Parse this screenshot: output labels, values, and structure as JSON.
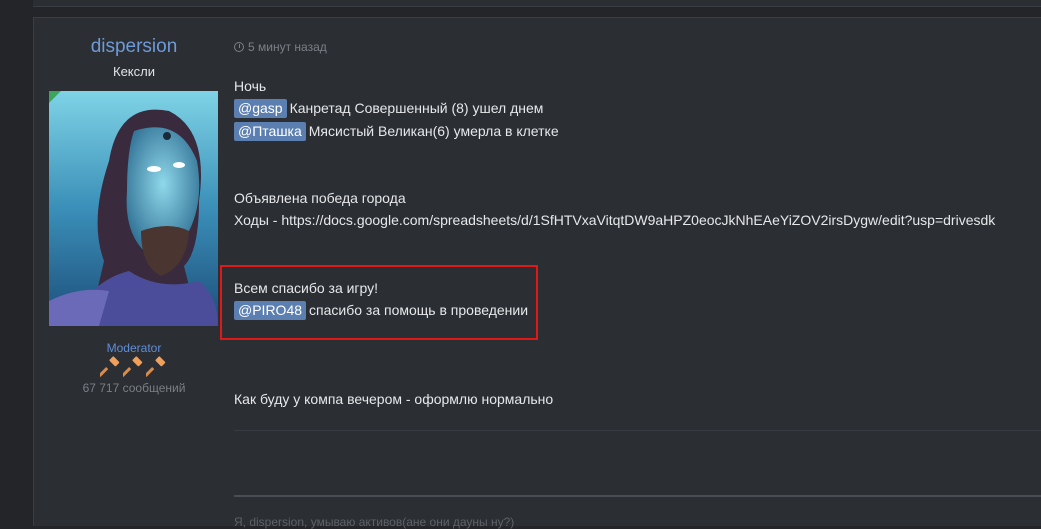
{
  "post": {
    "author": {
      "name": "dispersion",
      "title": "Кексли",
      "role": "Moderator",
      "message_count": "67 717 сообщений"
    },
    "time": "5 минут назад",
    "lines": {
      "night": "Ночь",
      "m1_mention": "@gasp",
      "m1_text": "Канретад Совершенный (8) ушел днем",
      "m2_mention": "@Пташка",
      "m2_text": "Мясистый Великан(6) умерла в клетке",
      "victory": "Объявлена победа города",
      "moves": "Ходы - https://docs.google.com/spreadsheets/d/1SfHTVxaVitqtDW9aHPZ0eocJkNhEAeYiZOV2irsDygw/edit?usp=drivesdk",
      "thanks": "Всем спасибо за игру!",
      "m3_mention": "@PIRO48",
      "m3_text": "спасибо за помощь в проведении",
      "later": "Как буду у компа вечером - оформлю нормально"
    },
    "signature": "Я, dispersion, умываю активов(ане они дауны ну?)"
  },
  "colors": {
    "background": "#232529",
    "post_bg": "#2b2e33",
    "author_link": "#6e9ad8",
    "mention_bg": "#5b7fb0",
    "highlight_border": "#e01818"
  },
  "icons": {
    "time": "clock-icon",
    "badge": "gavel-icon"
  }
}
